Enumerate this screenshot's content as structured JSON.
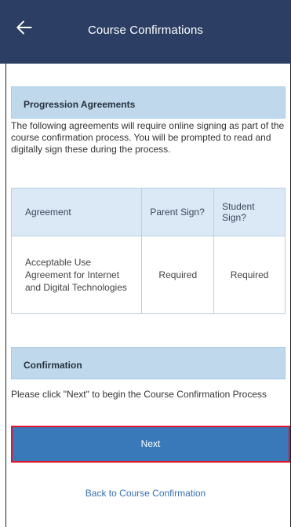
{
  "header": {
    "title": "Course Confirmations",
    "back_icon": "arrow-left-icon",
    "background": "#2c3e63"
  },
  "agreements_section": {
    "title": "Progression Agreements",
    "description": "The following agreements will require online signing as part of the course confirmation process. You will be prompted to read and digitally sign these during the process.",
    "table": {
      "columns": [
        "Agreement",
        "Parent Sign?",
        "Student Sign?"
      ],
      "rows": [
        {
          "agreement": "Acceptable Use Agreement for Internet and Digital Technologies",
          "parent": "Required",
          "student": "Required"
        }
      ]
    }
  },
  "confirmation_section": {
    "title": "Confirmation",
    "description": "Please click \"Next\" to begin the Course Confirmation Process"
  },
  "actions": {
    "next_label": "Next",
    "back_link_label": "Back to Course Confirmation",
    "primary_color": "#3a79b9",
    "highlight_border_color": "#e0142a"
  }
}
